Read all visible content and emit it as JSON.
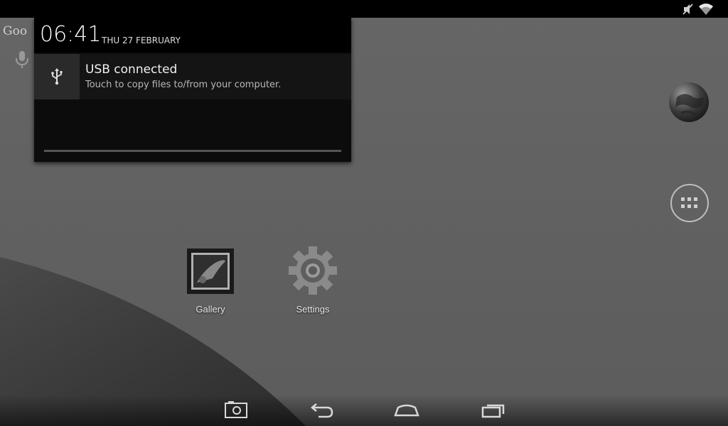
{
  "status_bar": {
    "icons": [
      "volume-muted-icon",
      "wifi-icon"
    ]
  },
  "home": {
    "search_hint": "Goo",
    "search_icon": "mic-icon",
    "apps": [
      {
        "label": "Gallery",
        "icon": "gallery-icon"
      },
      {
        "label": "Settings",
        "icon": "gear-icon"
      }
    ],
    "side_icons": [
      "browser-globe-icon",
      "all-apps-grid-icon"
    ]
  },
  "notification_shade": {
    "time": "06:41",
    "date": "THU 27 FEBRUARY",
    "notifications": [
      {
        "icon": "usb-icon",
        "title": "USB connected",
        "text": "Touch to copy files to/from your computer."
      }
    ]
  },
  "navigation": {
    "buttons": [
      "screenshot-icon",
      "back-icon",
      "home-icon",
      "recent-apps-icon"
    ]
  },
  "colors": {
    "wallpaper": "#6a6a6a",
    "wallpaper_curve": "#3a3a3a",
    "shade_background": "#0c0c0c"
  }
}
